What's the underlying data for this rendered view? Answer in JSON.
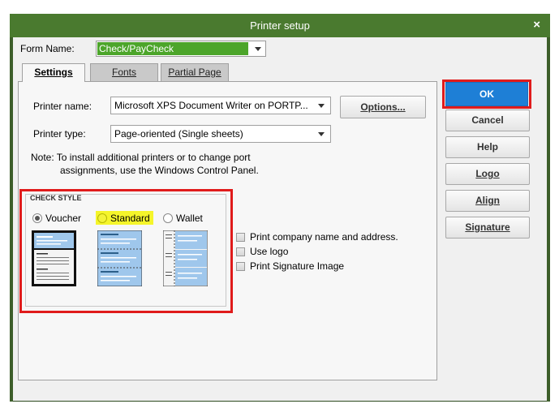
{
  "window": {
    "title": "Printer setup",
    "close_glyph": "×"
  },
  "form_name": {
    "label": "Form Name:",
    "value": "Check/PayCheck"
  },
  "tabs": [
    {
      "label": "Settings",
      "active": true
    },
    {
      "label": "Fonts",
      "active": false
    },
    {
      "label": "Partial Page",
      "active": false
    }
  ],
  "printer": {
    "name_label": "Printer name:",
    "name_value": "Microsoft XPS Document Writer on PORTP...",
    "type_label": "Printer type:",
    "type_value": "Page-oriented (Single sheets)",
    "options_label": "Options...",
    "note_line1": "Note: To install additional printers or to change port",
    "note_line2": "assignments, use the Windows Control Panel."
  },
  "check_style": {
    "heading": "CHECK STYLE",
    "options": [
      {
        "label": "Voucher",
        "selected": true
      },
      {
        "label": "Standard",
        "selected": false,
        "highlighted": true
      },
      {
        "label": "Wallet",
        "selected": false
      }
    ]
  },
  "checkboxes": [
    {
      "label": "Print company name and address.",
      "checked": false
    },
    {
      "label": "Use logo",
      "checked": false
    },
    {
      "label": "Print Signature Image",
      "checked": false
    }
  ],
  "buttons": {
    "ok": "OK",
    "cancel": "Cancel",
    "help": "Help",
    "logo": "Logo",
    "align": "Align",
    "signature": "Signature"
  },
  "colors": {
    "titlebar": "#4a7a2f",
    "form_value_bg": "#4ca52a",
    "ok_button": "#1e7fd6",
    "highlight_box": "#e01b1b",
    "standard_highlight": "#f3f338"
  }
}
